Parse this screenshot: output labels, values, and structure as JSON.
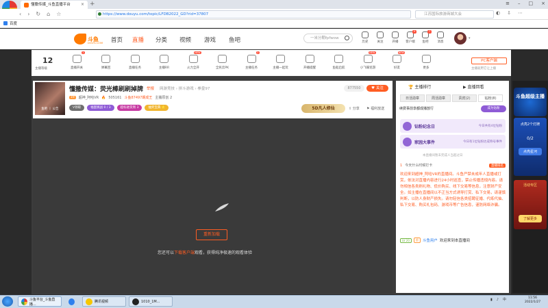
{
  "browser": {
    "logo_label": "极速浏览器",
    "tab_title": "懂撒传媒_斗鱼直播平台",
    "url": "https://www.douyu.com/topic/LFDB2022_GD?rid=37807",
    "ext_search_placeholder": "江苏国际旅游商城大会",
    "bookmark": "百度"
  },
  "site": {
    "logo_text": "斗鱼",
    "logo_sub": "DOUYU.COM",
    "nav": [
      "首页",
      "直播",
      "分类",
      "视频",
      "游戏",
      "鱼吧"
    ],
    "search_placeholder": "一米分期fpfwow",
    "tools": [
      {
        "label": "历史",
        "badge": ""
      },
      {
        "label": "关注",
        "badge": ""
      },
      {
        "label": "开播",
        "badge": ""
      },
      {
        "label": "客户端",
        "badge": "9"
      },
      {
        "label": "鱼吧",
        "badge": "7"
      },
      {
        "label": "消息",
        "badge": ""
      }
    ]
  },
  "toolbar": {
    "level": "12",
    "level_label": "主播等级",
    "items": [
      {
        "label": "直播开关",
        "badge": "1"
      },
      {
        "label": "弹幕回",
        "badge": ""
      },
      {
        "label": "直播任务",
        "badge": ""
      },
      {
        "label": "主播RR",
        "badge": ""
      },
      {
        "label": "火力全开",
        "badge": "NEW"
      },
      {
        "label": "全民云PK",
        "badge": ""
      },
      {
        "label": "主播任务",
        "badge": "2"
      },
      {
        "label": "主播一起玩",
        "badge": ""
      },
      {
        "label": "开播提醒",
        "badge": ""
      },
      {
        "label": "鱼船启航",
        "badge": ""
      },
      {
        "label": "小飞碟巡游",
        "badge": "NEW"
      },
      {
        "label": "好友",
        "badge": "NEW"
      },
      {
        "label": "更多",
        "badge": ""
      }
    ],
    "pc_client": "PC客户端",
    "pc_client_sub": "主播就用它让上播"
  },
  "room": {
    "thumb_caption": "鱼吧 丨 公告",
    "title": "懂撒传媒：荧光棒刷刷掉牌",
    "tag": "举报",
    "category": "网游竞技 › 拼斗游戏 › 拳皇97",
    "follow_count": "877550",
    "follow_label": "关注",
    "anchor_level": "19",
    "anchor_name": "超神_阿哈VR",
    "hot": "505161",
    "anchor_meta": "斗鱼87497期成王",
    "fan_count": "主播原创 2",
    "tags": [
      {
        "label": "V领取",
        "color": "#6f6f6f"
      },
      {
        "label": "福蛋挑战 0 / 3",
        "color": "#8e5bd6"
      },
      {
        "label": "超标进货周 3",
        "color": "#c73aa3"
      },
      {
        "label": "抽奖宝典 ⭐",
        "color": "#f1b52e"
      }
    ],
    "badge_5d": "5D凡人修仙",
    "share": "分享",
    "report": "福利放送"
  },
  "video": {
    "retry": "重新加载",
    "msg_prefix": "您还可以",
    "msg_link": "下载客户端",
    "msg_suffix": "观看，获得纯净极速的观看体验"
  },
  "side": {
    "tab1": "主播排行",
    "tab2": "直播回看",
    "subtabs": [
      "日活勋章",
      "周活勋章",
      "贵宾(2)",
      "钻粉(8)"
    ],
    "notice": "续费事前享都成播放行",
    "notice_btn": "成为钻粉",
    "card1_title": "钻粉纪念日",
    "card1_right": "今日共有4位钻粉",
    "card2_title": "家园大事件",
    "card2_right": "今日有1位钻粉达成称号事件",
    "hint": "本直播间暂未完成人当超过日",
    "rank_text": "今天什么时候打卡",
    "rank_btn": "直播排名",
    "welcome": "欢迎来到超神_阿哈VR的直播间。斗鱼严禁未成年人直播或打赏，依法对直播内容进行24小时巡查，禁止传播违规内容。请勿相信各类刷礼物、低价购买、线下交易等信息，注意财产安全。如主播在直播间以不正当方式诱导打赏、私下交易，请谨慎判断，以防人身财产损失。请勿轻信各类招聘征婚、代练代抽、私下交易、购买礼包码、游戏币等广告信息，谨防网络诈骗。",
    "chat_level": "LV 20",
    "chat_badge": "超",
    "chat_user": "斗鱼用户",
    "chat_text": "欢迎来到本直播间"
  },
  "ads": {
    "ad1": "斗鱼超级主播",
    "ad2_title": "点亮2个灯牌",
    "ad2_progress": "0/2",
    "ad2_btn": "点亮星河",
    "ad3_title": "活动专区",
    "ad3_btn": "了解更多"
  },
  "taskbar": {
    "tasks": [
      "斗鱼平台_斗鱼直播...",
      "",
      "腾讯视频",
      "1010_1M..."
    ],
    "clock_time": "11:56",
    "clock_date": "2022/1/27"
  }
}
